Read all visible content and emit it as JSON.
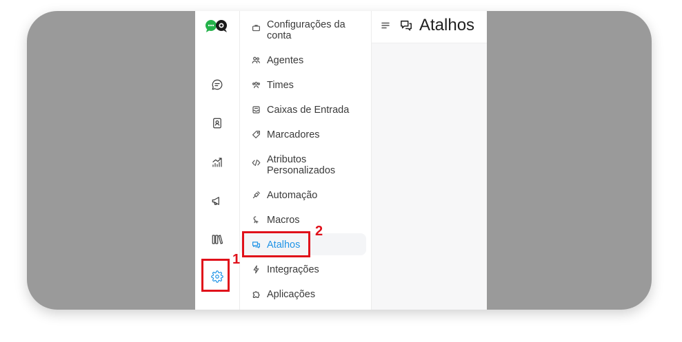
{
  "page": {
    "title": "Atalhos"
  },
  "rail": {
    "items": [
      {
        "name": "conversations-icon"
      },
      {
        "name": "contacts-icon"
      },
      {
        "name": "reports-icon"
      },
      {
        "name": "campaigns-icon"
      },
      {
        "name": "library-icon"
      },
      {
        "name": "settings-icon",
        "active": true
      }
    ]
  },
  "settings_menu": {
    "items": [
      {
        "label": "Configurações da conta",
        "icon": "briefcase-icon"
      },
      {
        "label": "Agentes",
        "icon": "people-icon"
      },
      {
        "label": "Times",
        "icon": "team-icon"
      },
      {
        "label": "Caixas de Entrada",
        "icon": "inbox-icon"
      },
      {
        "label": "Marcadores",
        "icon": "tag-icon"
      },
      {
        "label": "Atributos Personalizados",
        "icon": "code-icon"
      },
      {
        "label": "Automação",
        "icon": "automation-icon"
      },
      {
        "label": "Macros",
        "icon": "macro-icon"
      },
      {
        "label": "Atalhos",
        "icon": "chat-bubbles-icon",
        "active": true
      },
      {
        "label": "Integrações",
        "icon": "lightning-icon"
      },
      {
        "label": "Aplicações",
        "icon": "puzzle-icon"
      }
    ]
  },
  "annotations": {
    "step1": "1",
    "step2": "2",
    "color": "#e0101a"
  },
  "accent": "#1f93e6"
}
